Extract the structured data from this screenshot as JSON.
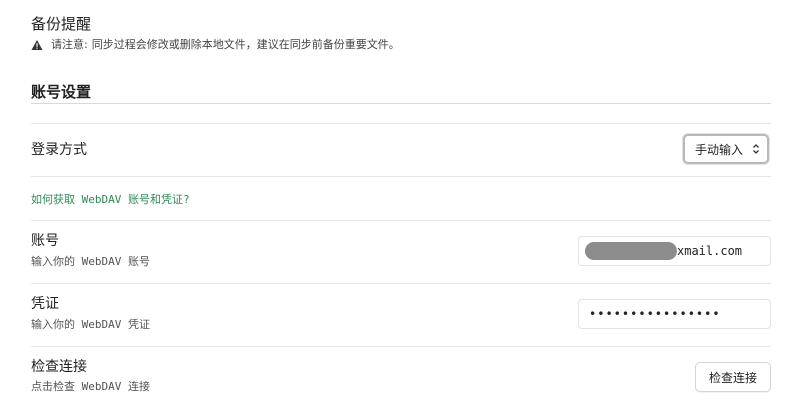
{
  "backup": {
    "title": "备份提醒",
    "notice_label": "请注意:",
    "notice_text": "同步过程会修改或删除本地文件，建议在同步前备份重要文件。",
    "notice_icon": "warning-triangle-icon"
  },
  "account_settings": {
    "section_title": "账号设置",
    "login_method": {
      "label": "登录方式",
      "selected": "手动输入"
    },
    "help_link": "如何获取 WebDAV 账号和凭证?",
    "account": {
      "label": "账号",
      "description": "输入你的 WebDAV 账号",
      "value_visible": "xmail.com"
    },
    "credential": {
      "label": "凭证",
      "description": "输入你的 WebDAV 凭证",
      "value": "••••••••••••••••"
    },
    "check_connection": {
      "label": "检查连接",
      "description": "点击检查 WebDAV 连接",
      "button_label": "检查连接"
    }
  },
  "colors": {
    "link": "#2e8b57",
    "divider": "#e6e6e6",
    "text": "#222222",
    "muted": "#555555"
  }
}
